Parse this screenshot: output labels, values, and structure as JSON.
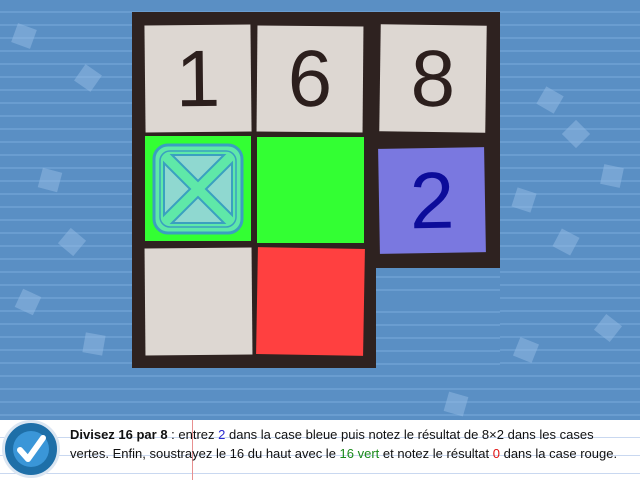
{
  "grid": {
    "row1": [
      "1",
      "6",
      "8"
    ],
    "row2": {
      "cell1": "",
      "cell2": "",
      "cell3": "2"
    },
    "row3": {
      "cell1": "",
      "cell2": ""
    }
  },
  "colors": {
    "board": "#2e2220",
    "gray_cell": "#ddd7d2",
    "green_cell": "#33ff33",
    "blue_cell": "#7a78e0",
    "red_cell": "#ff4040",
    "background": "#5a8fc4"
  },
  "icons": {
    "cursor": "crosshair-selector-icon",
    "validate": "checkmark-icon"
  },
  "instructions": {
    "bold": "Divisez 16 par 8",
    "t1": " : entrez ",
    "n1": "2",
    "t2": " dans la case bleue puis notez le résultat de 8×2 dans les cases vertes. Enfin, soustrayez le 16 du haut avec le ",
    "green": "16 vert",
    "t3": " et notez le résultat ",
    "red": "0",
    "t4": " dans la case rouge."
  }
}
